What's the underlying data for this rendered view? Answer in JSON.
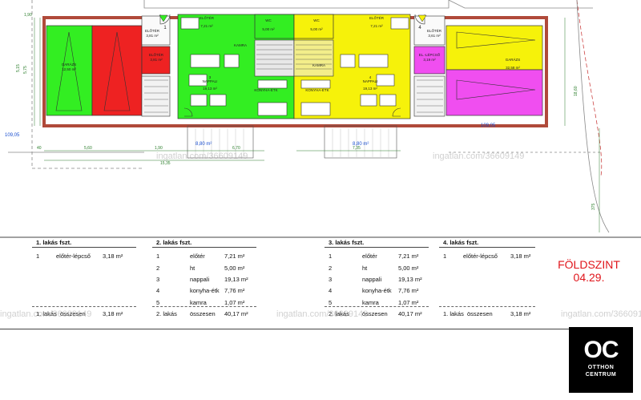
{
  "plan": {
    "dimensions": {
      "top_left": "1,90",
      "left_a": "5,15",
      "left_b": "5,75",
      "left_total": "109,05",
      "right_total": "109,05",
      "right_side": "18,60",
      "right_lower": "375",
      "bottom_a": "5,60",
      "bottom_b": "1,90",
      "bottom_c": "6,70",
      "bottom_d": "7,35",
      "bottom_total": "15,35",
      "bottom_small": "40",
      "terrace_left": "8,80 m²",
      "terrace_right": "8,80 m²"
    },
    "rooms": [
      {
        "num": "",
        "name": "GARÁZS",
        "sub": "beton",
        "area": "12,50 m²"
      },
      {
        "num": "1",
        "name": "ELŐTÉR",
        "sub": "kerámia",
        "area": "3,81 m²"
      },
      {
        "num": "",
        "name": "ELŐTÉR",
        "sub": "kerámia",
        "area": "3,81 m²"
      },
      {
        "num": "1",
        "name": "ELŐTÉR",
        "sub": "kerámia",
        "area": "7,21 m²"
      },
      {
        "num": "2",
        "name": "WC",
        "sub": "kerámia",
        "area": "5,00 m²"
      },
      {
        "num": "",
        "name": "KAMRA",
        "sub": "kerámia",
        "area": ""
      },
      {
        "num": "3",
        "name": "NAPPALI",
        "sub": "laminált",
        "area": "19,13 m²"
      },
      {
        "num": "",
        "name": "KONYHA-ÉTK",
        "sub": "kerámia",
        "area": ""
      },
      {
        "num": "3",
        "name": "WC",
        "sub": "kerámia",
        "area": "5,00 m²"
      },
      {
        "num": "1",
        "name": "ELŐTÉR",
        "sub": "kerámia",
        "area": "7,21 m²"
      },
      {
        "num": "",
        "name": "KAMRA",
        "sub": "kerámia",
        "area": ""
      },
      {
        "num": "4",
        "name": "NAPPALI",
        "sub": "laminált",
        "area": "19,13 m²"
      },
      {
        "num": "",
        "name": "KONYHA-ÉTK",
        "sub": "kerámia",
        "area": ""
      },
      {
        "num": "4",
        "name": "ELŐTÉR",
        "sub": "kerámia",
        "area": "3,61 m²"
      },
      {
        "num": "",
        "name": "EL.-LÉPCSŐ",
        "sub": "kerámia",
        "area": "3,19 m²"
      },
      {
        "num": "",
        "name": "GARÁZS",
        "sub": "kerámia",
        "area": "32,58 m²"
      }
    ],
    "watermark": "ingatlan.com/36609149",
    "stair_labels": [
      "1",
      "2",
      "3",
      "4"
    ]
  },
  "tables": [
    {
      "title": "1. lakás fszt.",
      "rows": [
        {
          "num": "1",
          "name": "előtér-lépcső",
          "area": "3,18 m²"
        }
      ],
      "total": {
        "label": "1. lakás",
        "word": "összesen",
        "area": "3,18 m²"
      }
    },
    {
      "title": "2. lakás fszt.",
      "rows": [
        {
          "num": "1",
          "name": "előtér",
          "area": "7,21 m²"
        },
        {
          "num": "2",
          "name": "ht",
          "area": "5,00 m²"
        },
        {
          "num": "3",
          "name": "nappali",
          "area": "19,13 m²"
        },
        {
          "num": "4",
          "name": "konyha-étk",
          "area": "7,76 m²"
        },
        {
          "num": "5",
          "name": "kamra",
          "area": "1,07 m²"
        }
      ],
      "total": {
        "label": "2. lakás",
        "word": "összesen",
        "area": "40,17 m²"
      }
    },
    {
      "title": "3. lakás fszt.",
      "rows": [
        {
          "num": "1",
          "name": "előtér",
          "area": "7,21 m²"
        },
        {
          "num": "2",
          "name": "ht",
          "area": "5,00 m²"
        },
        {
          "num": "3",
          "name": "nappali",
          "area": "19,13 m²"
        },
        {
          "num": "4",
          "name": "konyha-étk",
          "area": "7,76 m²"
        },
        {
          "num": "5",
          "name": "kamra",
          "area": "1,07 m²"
        }
      ],
      "total": {
        "label": "2. lakás",
        "word": "összesen",
        "area": "40,17 m²"
      }
    },
    {
      "title": "4. lakás fszt.",
      "rows": [
        {
          "num": "1",
          "name": "előtér-lépcső",
          "area": "3,18 m²"
        }
      ],
      "total": {
        "label": "1. lakás",
        "word": "összesen",
        "area": "3,18 m²"
      }
    }
  ],
  "stamp": {
    "line1": "FÖLDSZINT",
    "line2": "04.29."
  },
  "logo": {
    "mark": "OC",
    "line1": "OTTHON",
    "line2": "CENTRUM"
  },
  "colors": {
    "green": "#33ee22",
    "red": "#ee2222",
    "yellow": "#f6f20a",
    "magenta": "#f04ef0",
    "wall": "#b04a3a",
    "stamp": "#e0151b"
  }
}
